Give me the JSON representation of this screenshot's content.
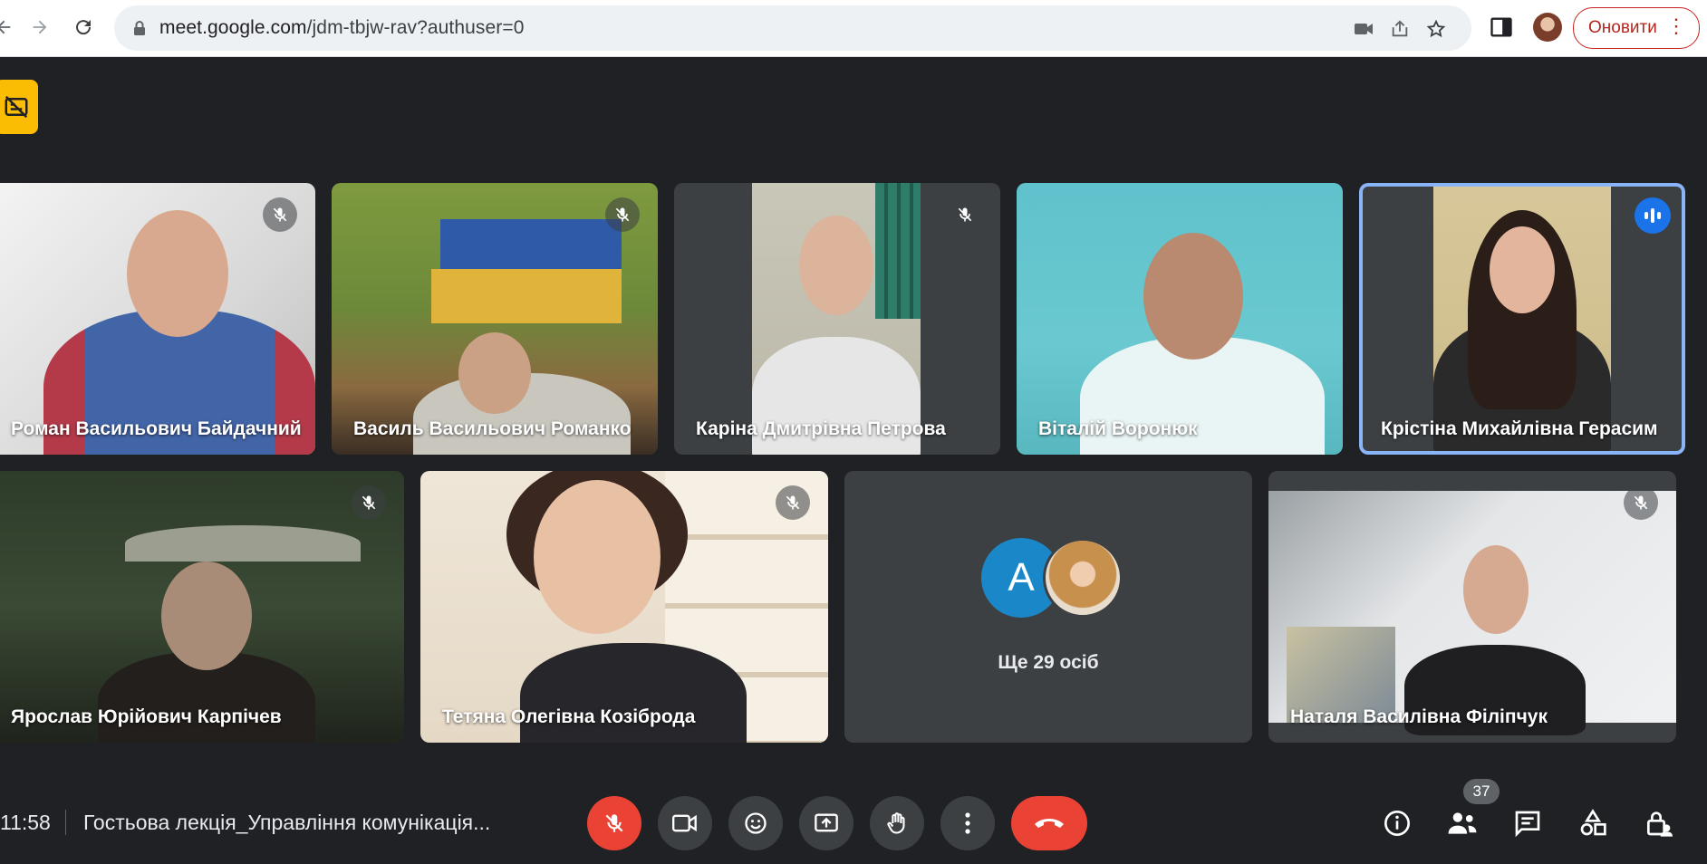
{
  "browser": {
    "url_host": "meet.google.com",
    "url_path": "/jdm-tbjw-rav?authuser=0",
    "update_label": "Оновити",
    "icons": [
      "back-arrow-icon",
      "forward-arrow-icon",
      "reload-icon",
      "lock-icon",
      "camera-blocked-icon",
      "share-icon",
      "star-icon",
      "side-panel-icon",
      "profile-avatar",
      "more-vert-icon"
    ]
  },
  "participants": [
    {
      "name": "Роман Васильович Байдачний",
      "muted": true
    },
    {
      "name": "Василь Васильович Романко",
      "muted": true
    },
    {
      "name": "Каріна Дмитрівна Петрова",
      "muted": true
    },
    {
      "name": "Віталій Воронюк",
      "muted": false
    },
    {
      "name": "Крістіна Михайлівна Герасим",
      "muted": false,
      "speaking": true
    },
    {
      "name": "Ярослав Юрійович Карпічев",
      "muted": true
    },
    {
      "name": "Тетяна Олегівна Козіброда",
      "muted": true
    },
    {
      "name": "Наталя Василівна Філіпчук",
      "muted": true
    }
  ],
  "others": {
    "avatar_letter": "A",
    "label": "Ще 29 осіб"
  },
  "bottom_bar": {
    "time": "11:58",
    "meeting_title": "Гостьова лекція_Управління комунікація...",
    "participant_count": "37",
    "controls": [
      "mic-off",
      "camera",
      "emoji",
      "present",
      "raise-hand",
      "more-options",
      "leave-call"
    ],
    "right_controls": [
      "meeting-info",
      "people",
      "chat",
      "activities",
      "host-controls"
    ]
  },
  "colors": {
    "stage_bg": "#202124",
    "tile_bg": "#3c4043",
    "danger": "#ea4335",
    "accent": "#8ab4f8",
    "speaking": "#1a73e8",
    "badge": "#fbbc04"
  }
}
